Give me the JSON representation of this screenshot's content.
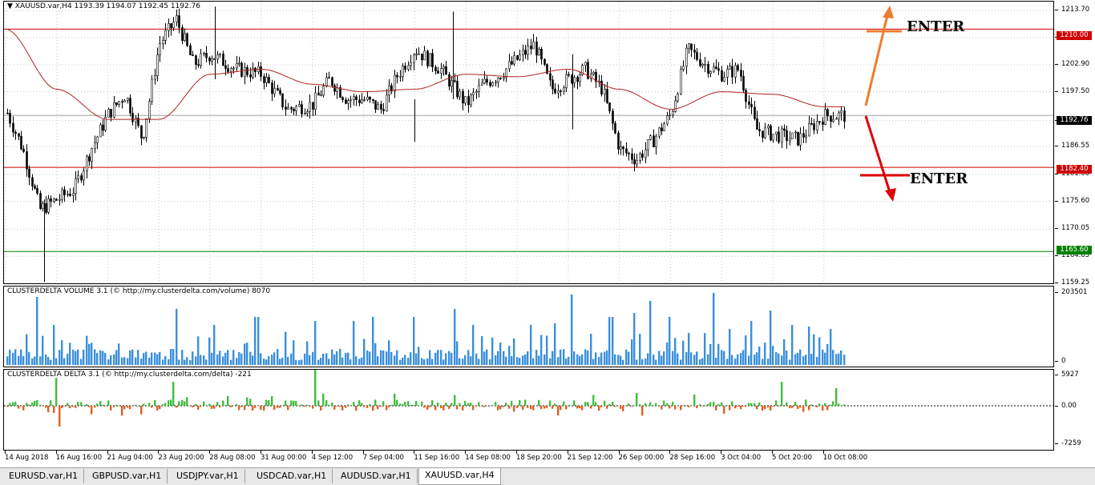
{
  "window": {
    "title": "XAUUSD.var,H4",
    "ohlc": "1193.39 1194.07 1192.45 1192.76",
    "triangle": "▼"
  },
  "main_axis": {
    "ticks": [
      "1213.70",
      "1208.30",
      "1202.90",
      "1197.50",
      "1191.75",
      "1186.55",
      "1181.00",
      "1175.60",
      "1170.05",
      "1164.65",
      "1159.25"
    ]
  },
  "levels": {
    "upper": {
      "value": 1210.0,
      "label": "1210.00",
      "color": "#d00000"
    },
    "current": {
      "value": 1192.76,
      "label": "1192.76",
      "color": "#000000"
    },
    "lower": {
      "value": 1182.4,
      "label": "1182.40",
      "color": "#d00000"
    },
    "green": {
      "value": 1165.6,
      "label": "1165.60",
      "color": "#008000"
    }
  },
  "annotations": {
    "enter_up": {
      "text": "ENTER",
      "color": "#ee7d30"
    },
    "enter_down": {
      "text": "ENTER",
      "color": "#e00000"
    }
  },
  "volume": {
    "title": "CLUSTERDELTA VOLUME 3.1 (© http://my.clusterdelta.com/volume) 8070",
    "max_label": "203501",
    "min_label": "0",
    "color": "#3a8fdc"
  },
  "delta": {
    "title": "CLUSTERDELTA DELTA 3.1 (© http://my.clusterdelta.com/delta) -221",
    "top_label": "5927",
    "zero_label": "0.00",
    "bottom_label": "-7259",
    "pos_color": "#3fbf3f",
    "neg_color": "#e06020"
  },
  "time_axis": [
    "14 Aug 2018",
    "16 Aug 16:00",
    "21 Aug 04:00",
    "23 Aug 20:00",
    "28 Aug 08:00",
    "31 Aug 00:00",
    "4 Sep 12:00",
    "7 Sep 04:00",
    "11 Sep 16:00",
    "14 Sep 08:00",
    "18 Sep 20:00",
    "21 Sep 12:00",
    "26 Sep 00:00",
    "28 Sep 16:00",
    "3 Oct 04:00",
    "5 Oct 20:00",
    "10 Oct 08:00"
  ],
  "tabs": [
    "EURUSD.var,H1",
    "GBPUSD.var,H1",
    "USDJPY.var,H1",
    "USDCAD.var,H1",
    "AUDUSD.var,H1",
    "XAUUSD.var,H4"
  ],
  "active_tab": "XAUUSD.var,H4",
  "chart_data": {
    "type": "candlestick",
    "symbol": "XAUUSD.var",
    "timeframe": "H4",
    "ylim": [
      1159.25,
      1215.5
    ],
    "close_path": [
      {
        "x": "14 Aug 2018",
        "y": 1194
      },
      {
        "x": "15 Aug 2018",
        "y": 1186
      },
      {
        "x": "16 Aug 00:00",
        "y": 1174
      },
      {
        "x": "16 Aug 16:00",
        "y": 1176
      },
      {
        "x": "17 Aug 12:00",
        "y": 1178
      },
      {
        "x": "20 Aug 00:00",
        "y": 1186
      },
      {
        "x": "21 Aug 04:00",
        "y": 1193
      },
      {
        "x": "22 Aug 00:00",
        "y": 1197
      },
      {
        "x": "23 Aug 00:00",
        "y": 1188
      },
      {
        "x": "23 Aug 20:00",
        "y": 1207
      },
      {
        "x": "24 Aug 12:00",
        "y": 1212
      },
      {
        "x": "27 Aug 12:00",
        "y": 1203
      },
      {
        "x": "28 Aug 08:00",
        "y": 1205
      },
      {
        "x": "30 Aug 00:00",
        "y": 1202
      },
      {
        "x": "31 Aug 00:00",
        "y": 1201
      },
      {
        "x": "3 Sep 00:00",
        "y": 1194
      },
      {
        "x": "4 Sep 12:00",
        "y": 1195
      },
      {
        "x": "5 Sep 12:00",
        "y": 1200
      },
      {
        "x": "6 Sep 12:00",
        "y": 1196
      },
      {
        "x": "7 Sep 04:00",
        "y": 1196
      },
      {
        "x": "10 Sep 00:00",
        "y": 1194
      },
      {
        "x": "11 Sep 00:00",
        "y": 1201
      },
      {
        "x": "11 Sep 16:00",
        "y": 1206
      },
      {
        "x": "13 Sep 00:00",
        "y": 1202
      },
      {
        "x": "14 Sep 08:00",
        "y": 1195
      },
      {
        "x": "17 Sep 00:00",
        "y": 1199
      },
      {
        "x": "18 Sep 00:00",
        "y": 1201
      },
      {
        "x": "18 Sep 20:00",
        "y": 1204
      },
      {
        "x": "20 Sep 00:00",
        "y": 1207
      },
      {
        "x": "21 Sep 00:00",
        "y": 1198
      },
      {
        "x": "21 Sep 12:00",
        "y": 1200
      },
      {
        "x": "24 Sep 00:00",
        "y": 1202
      },
      {
        "x": "25 Sep 00:00",
        "y": 1198
      },
      {
        "x": "26 Sep 00:00",
        "y": 1186
      },
      {
        "x": "27 Sep 00:00",
        "y": 1184
      },
      {
        "x": "28 Sep 00:00",
        "y": 1188
      },
      {
        "x": "28 Sep 16:00",
        "y": 1193
      },
      {
        "x": "1 Oct 00:00",
        "y": 1206
      },
      {
        "x": "2 Oct 00:00",
        "y": 1203
      },
      {
        "x": "3 Oct 04:00",
        "y": 1201
      },
      {
        "x": "4 Oct 00:00",
        "y": 1202
      },
      {
        "x": "5 Oct 00:00",
        "y": 1190
      },
      {
        "x": "5 Oct 20:00",
        "y": 1189
      },
      {
        "x": "9 Oct 00:00",
        "y": 1188
      },
      {
        "x": "10 Oct 08:00",
        "y": 1192.76
      }
    ],
    "ma_path": [
      {
        "x": "14 Aug 2018",
        "y": 1210
      },
      {
        "x": "16 Aug 16:00",
        "y": 1198
      },
      {
        "x": "21 Aug 04:00",
        "y": 1192
      },
      {
        "x": "23 Aug 20:00",
        "y": 1192
      },
      {
        "x": "28 Aug 08:00",
        "y": 1201
      },
      {
        "x": "31 Aug 00:00",
        "y": 1202
      },
      {
        "x": "4 Sep 12:00",
        "y": 1199
      },
      {
        "x": "7 Sep 04:00",
        "y": 1197.5
      },
      {
        "x": "11 Sep 16:00",
        "y": 1198
      },
      {
        "x": "14 Sep 08:00",
        "y": 1201
      },
      {
        "x": "18 Sep 20:00",
        "y": 1200.5
      },
      {
        "x": "21 Sep 12:00",
        "y": 1202
      },
      {
        "x": "26 Sep 00:00",
        "y": 1198
      },
      {
        "x": "28 Sep 16:00",
        "y": 1194
      },
      {
        "x": "3 Oct 04:00",
        "y": 1197.5
      },
      {
        "x": "5 Oct 20:00",
        "y": 1197
      },
      {
        "x": "10 Oct 08:00",
        "y": 1194.5
      }
    ]
  }
}
